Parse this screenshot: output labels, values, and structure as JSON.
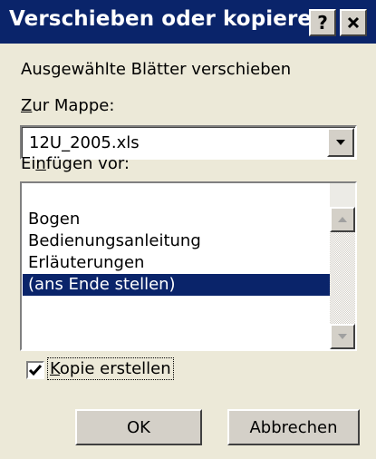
{
  "dialog": {
    "title": "Verschieben oder kopieren",
    "help_glyph": "?",
    "move_label": "Ausgewählte Blätter verschieben",
    "book_label_access": "Z",
    "book_label_rest": "ur Mappe:",
    "book_value": "12U_2005.xls",
    "before_label_pre": "Ei",
    "before_label_access": "n",
    "before_label_rest": "fügen vor:",
    "sheets": [
      {
        "label": "Bogen"
      },
      {
        "label": "Bedienungsanleitung"
      },
      {
        "label": "Erläuterungen"
      },
      {
        "label": "(ans Ende stellen)",
        "selected": true
      }
    ],
    "copy_checked": true,
    "copy_label_access": "K",
    "copy_label_rest": "opie erstellen",
    "ok_label": "OK",
    "cancel_label": "Abbrechen"
  },
  "colors": {
    "title_bar": "#0a246a",
    "selection": "#0a246a",
    "face": "#ece9d8"
  }
}
